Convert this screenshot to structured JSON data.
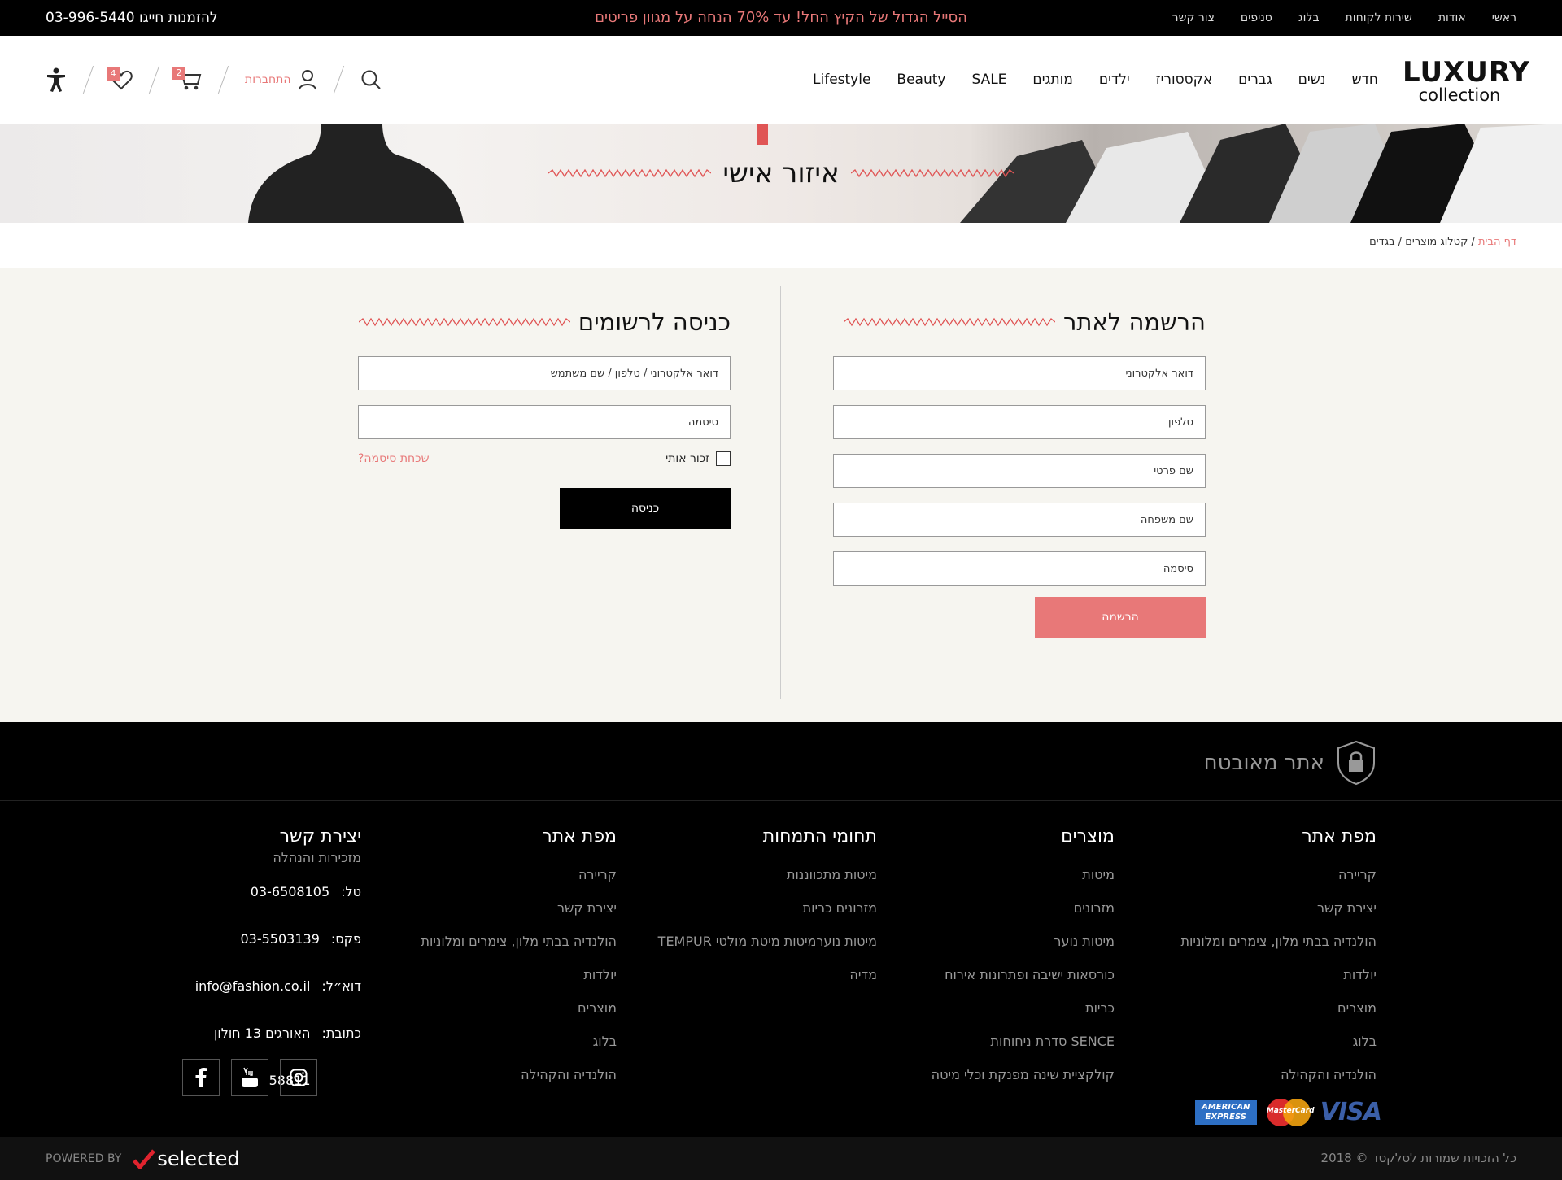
{
  "topbar": {
    "links": [
      "ראשי",
      "אודות",
      "שירות לקוחות",
      "בלוג",
      "סניפים",
      "צור קשר"
    ],
    "promo": "הסייל הגדול של הקיץ החל! עד 70% הנחה על מגוון פריטים",
    "phone_label": "להזמנות חייגו",
    "phone": "03-996-5440"
  },
  "header": {
    "logo_line1": "LUXURY",
    "logo_line2": "collection",
    "nav": [
      "חדש",
      "נשים",
      "גברים",
      "אקססוריז",
      "ילדים",
      "מותגים",
      "SALE",
      "Beauty",
      "Lifestyle"
    ],
    "login_label": "התחברות",
    "cart_count": "2",
    "wishlist_count": "4",
    "icons": [
      "search-icon",
      "user-icon",
      "cart-icon",
      "heart-icon",
      "accessibility-icon"
    ]
  },
  "banner": {
    "title": "איזור אישי"
  },
  "breadcrumb": {
    "home": "דף הבית",
    "items": [
      "קטלוג מוצרים",
      "בגדים"
    ],
    "sep": " / "
  },
  "register": {
    "title": "הרשמה לאתר",
    "fields": [
      "דואר אלקטרוני",
      "טלפון",
      "שם פרטי",
      "שם משפחה",
      "סיסמה"
    ],
    "button": "הרשמה"
  },
  "login": {
    "title": "כניסה לרשומים",
    "fields": [
      "דואר אלקטרוני / טלפון / שם משתמש",
      "סיסמה"
    ],
    "remember": "זכור אותי",
    "forgot": "שכחת סיסמה?",
    "button": "כניסה"
  },
  "footer": {
    "secure": "אתר מאובטח",
    "col1": {
      "title": "מפת אתר",
      "items": [
        "קריירה",
        "יצירת קשר",
        "הולנדיה בבתי מלון, צימרים ומלוניות",
        "יולדות",
        "מוצרים",
        "בלוג",
        "הולנדיה והקהילה"
      ]
    },
    "col2": {
      "title": "מוצרים",
      "items": [
        "מיטות",
        "מזרונים",
        "מיטות נוער",
        "כורסאות ישיבה ופתרונות אירוח",
        "כריות",
        "SENCE סדרת ניחוחות",
        "קולקציית שינה מפנקת וכלי מיטה"
      ]
    },
    "col3": {
      "title": "תחומי התמחות",
      "items": [
        "מיטות מתכווננות",
        "מזרונים כריות",
        "מיטות נוערמיטות מיטת מולטי TEMPUR",
        "מדיה"
      ]
    },
    "col4": {
      "title": "מפת אתר",
      "items": [
        "קריירה",
        "יצירת קשר",
        "הולנדיה בבתי מלון, צימרים ומלוניות",
        "יולדות",
        "מוצרים",
        "בלוג",
        "הולנדיה והקהילה"
      ]
    },
    "contact": {
      "title": "יצירת קשר",
      "subtitle": "מזכירות והנהלה",
      "rows": [
        {
          "label": "טל:",
          "value": "03-6508105"
        },
        {
          "label": "פקס:",
          "value": "03-5503139"
        },
        {
          "label": "דוא״ל:",
          "value": "info@fashion.co.il"
        },
        {
          "label": "כתובת:",
          "value": "האורגים 13 חולון 58811"
        }
      ]
    },
    "payment": [
      "AMERICAN EXPRESS",
      "MasterCard",
      "VISA"
    ],
    "amex_line1": "AMERICAN",
    "amex_line2": "EXPRESS"
  },
  "bottom": {
    "copyright": "כל הזכויות שמורות לסלקטד © 2018",
    "powered": "POWERED BY",
    "brand": "selected"
  },
  "colors": {
    "accent": "#e87878",
    "dark": "#000000",
    "formbg": "#f6f5f0"
  }
}
